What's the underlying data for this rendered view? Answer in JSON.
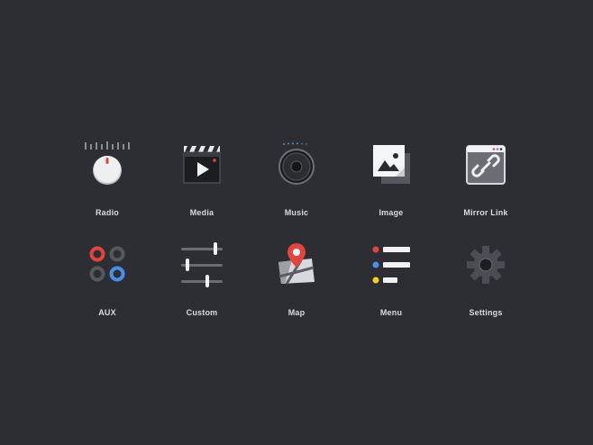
{
  "menu": {
    "items": [
      {
        "label": "Radio",
        "icon": "radio-dial-icon"
      },
      {
        "label": "Media",
        "icon": "media-clapperboard-icon"
      },
      {
        "label": "Music",
        "icon": "music-speaker-icon"
      },
      {
        "label": "Image",
        "icon": "image-photo-icon"
      },
      {
        "label": "Mirror Link",
        "icon": "mirror-link-icon"
      },
      {
        "label": "AUX",
        "icon": "aux-ports-icon"
      },
      {
        "label": "Custom",
        "icon": "custom-sliders-icon"
      },
      {
        "label": "Map",
        "icon": "map-pin-icon"
      },
      {
        "label": "Menu",
        "icon": "menu-list-icon"
      },
      {
        "label": "Settings",
        "icon": "settings-gear-icon"
      }
    ]
  },
  "colors": {
    "background": "#2c2e33",
    "label": "#d9dadd",
    "accent_red": "#e0463e",
    "accent_blue": "#4a90e2",
    "accent_yellow": "#f4d022"
  }
}
